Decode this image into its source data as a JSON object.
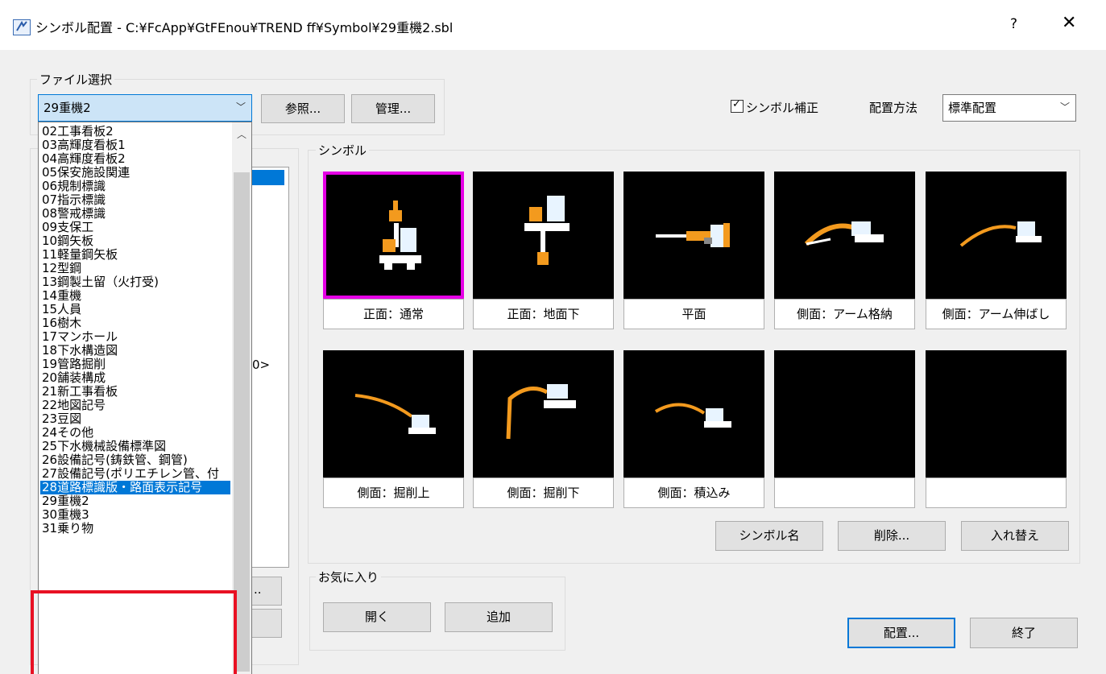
{
  "window": {
    "title": "シンボル配置 - C:¥FcApp¥GtFEnou¥TREND ff¥Symbol¥29重機2.sbl",
    "help": "?",
    "close": "✕"
  },
  "file_select": {
    "group_label": "ファイル選択",
    "selected": "29重機2",
    "browse_label": "参照...",
    "manage_label": "管理...",
    "options": [
      "02工事看板2",
      "03高輝度看板1",
      "04高輝度看板2",
      "05保安施設関連",
      "06規制標識",
      "07指示標識",
      "08警戒標識",
      "09支保工",
      "10鋼矢板",
      "11軽量鋼矢板",
      "12型鋼",
      "13鋼製土留（火打受)",
      "14重機",
      "15人員",
      "16樹木",
      "17マンホール",
      "18下水構造図",
      "19管路掘削",
      "20舗装構成",
      "21新工事看板",
      "22地図記号",
      "23豆図",
      "24その他",
      "25下水機械設備標準図",
      "26設備記号(鋳鉄管、鋼管)",
      "27設備記号(ポリエチレン管、付",
      "28道路標識版・路面表示記号",
      "29重機2",
      "30重機3",
      "31乗り物"
    ],
    "highlighted_index": 26
  },
  "options": {
    "symbol_correction_label": "シンボル補正",
    "symbol_correction_checked": true,
    "placement_method_label": "配置方法",
    "placement_method_value": "標準配置"
  },
  "symbols": {
    "group_label": "シンボル",
    "items": [
      {
        "label": "正面：通常"
      },
      {
        "label": "正面：地面下"
      },
      {
        "label": "平面"
      },
      {
        "label": "側面：アーム格納"
      },
      {
        "label": "側面：アーム伸ばし"
      },
      {
        "label": "側面：掘削上"
      },
      {
        "label": "側面：掘削下"
      },
      {
        "label": "側面：積込み"
      },
      {
        "label": ""
      },
      {
        "label": ""
      }
    ],
    "selected_index": 0,
    "name_button": "シンボル名",
    "delete_button": "削除...",
    "swap_button": "入れ替え"
  },
  "favorites": {
    "group_label": "お気に入り",
    "open_button": "開く",
    "add_button": "追加"
  },
  "hidden_peek": {
    "tree_suffix": "0>",
    "left_btn_suffix": ".."
  },
  "footer": {
    "place_button": "配置...",
    "exit_button": "終了"
  },
  "colors": {
    "accent": "#0078d7",
    "selection_border": "#e600e6",
    "callout_red": "#e81123",
    "machine_orange": "#f39a1e"
  }
}
